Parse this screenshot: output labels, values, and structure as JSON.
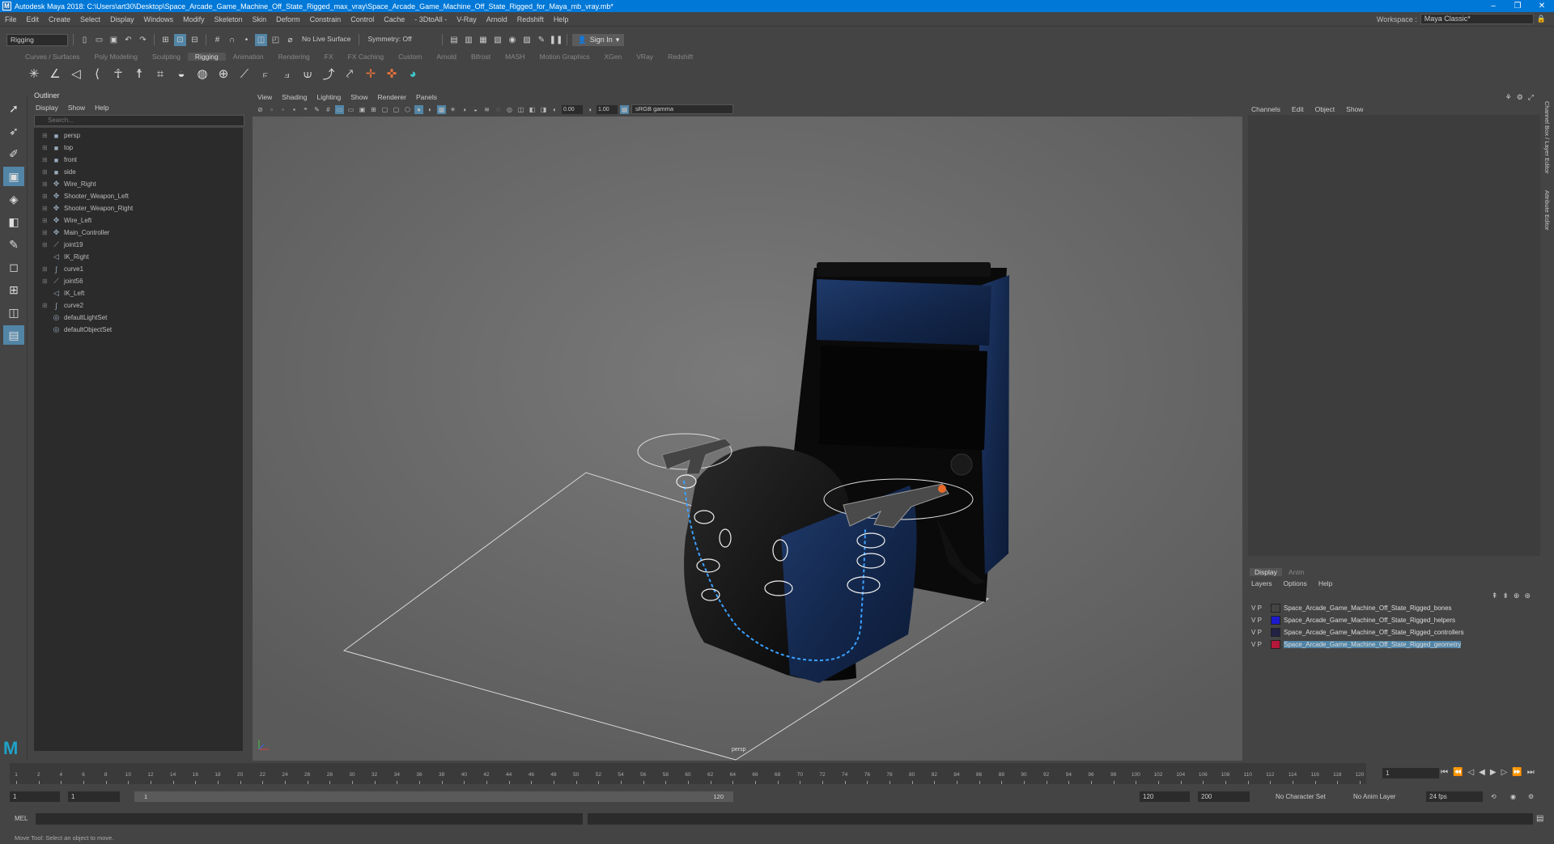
{
  "window": {
    "title": "Autodesk Maya 2018: C:\\Users\\art30\\Desktop\\Space_Arcade_Game_Machine_Off_State_Rigged_max_vray\\Space_Arcade_Game_Machine_Off_State_Rigged_for_Maya_mb_vray.mb*",
    "minimize": "–",
    "maximize": "❐",
    "close": "✕"
  },
  "menubar": {
    "items": [
      "File",
      "Edit",
      "Create",
      "Select",
      "Display",
      "Windows",
      "Modify",
      "Skeleton",
      "Skin",
      "Deform",
      "Constrain",
      "Control",
      "Cache",
      "- 3DtoAll -",
      "V-Ray",
      "Arnold",
      "Redshift",
      "Help"
    ],
    "workspace_label": "Workspace :",
    "workspace_value": "Maya Classic*"
  },
  "statusline": {
    "mode": "Rigging",
    "live_surface": "No Live Surface",
    "symmetry": "Symmetry: Off",
    "signin": "Sign In"
  },
  "shelf": {
    "tabs": [
      "Curves / Surfaces",
      "Poly Modeling",
      "Sculpting",
      "Rigging",
      "Animation",
      "Rendering",
      "FX",
      "FX Caching",
      "Custom",
      "Arnold",
      "Bifrost",
      "MASH",
      "Motion Graphics",
      "XGen",
      "VRay",
      "Redshift"
    ],
    "active_tab": "Rigging"
  },
  "outliner": {
    "header": "Outliner",
    "menu": [
      "Display",
      "Show",
      "Help"
    ],
    "search_placeholder": "Search...",
    "items": [
      {
        "label": "persp",
        "icon": "camera-icon"
      },
      {
        "label": "top",
        "icon": "camera-icon"
      },
      {
        "label": "front",
        "icon": "camera-icon"
      },
      {
        "label": "side",
        "icon": "camera-icon"
      },
      {
        "label": "Wire_Right",
        "icon": "transform-icon"
      },
      {
        "label": "Shooter_Weapon_Left",
        "icon": "transform-icon"
      },
      {
        "label": "Shooter_Weapon_Right",
        "icon": "transform-icon"
      },
      {
        "label": "Wire_Left",
        "icon": "transform-icon"
      },
      {
        "label": "Main_Controller",
        "icon": "transform-icon"
      },
      {
        "label": "joint19",
        "icon": "joint-icon"
      },
      {
        "label": "IK_Right",
        "icon": "ik-handle-icon"
      },
      {
        "label": "curve1",
        "icon": "curve-icon"
      },
      {
        "label": "joint56",
        "icon": "joint-icon"
      },
      {
        "label": "IK_Left",
        "icon": "ik-handle-icon"
      },
      {
        "label": "curve2",
        "icon": "curve-icon"
      },
      {
        "label": "defaultLightSet",
        "icon": "set-icon"
      },
      {
        "label": "defaultObjectSet",
        "icon": "set-icon"
      }
    ]
  },
  "viewport": {
    "menu": [
      "View",
      "Shading",
      "Lighting",
      "Show",
      "Renderer",
      "Panels"
    ],
    "exposure": "0.00",
    "gamma": "1.00",
    "color_space": "sRGB gamma",
    "camera_label": "persp"
  },
  "channel_box": {
    "menu": [
      "Channels",
      "Edit",
      "Object",
      "Show"
    ]
  },
  "layer_editor": {
    "tabs": [
      "Display",
      "Anim"
    ],
    "active_tab": "Display",
    "menu": [
      "Layers",
      "Options",
      "Help"
    ],
    "layers": [
      {
        "v": "V",
        "p": "P",
        "name": "Space_Arcade_Game_Machine_Off_State_Rigged_bones",
        "color": "#444444"
      },
      {
        "v": "V",
        "p": "P",
        "name": "Space_Arcade_Game_Machine_Off_State_Rigged_helpers",
        "color": "#1a1acc"
      },
      {
        "v": "V",
        "p": "P",
        "name": "Space_Arcade_Game_Machine_Off_State_Rigged_controllers",
        "color": "#222244"
      },
      {
        "v": "V",
        "p": "P",
        "name": "Space_Arcade_Game_Machine_Off_State_Rigged_geometry",
        "color": "#b3173a"
      }
    ]
  },
  "side_tabs": [
    "Channel Box / Layer Editor",
    "Attribute Editor"
  ],
  "timeslider": {
    "ticks": [
      "1",
      "2",
      "4",
      "6",
      "8",
      "10",
      "12",
      "14",
      "16",
      "18",
      "20",
      "22",
      "24",
      "26",
      "28",
      "30",
      "32",
      "34",
      "36",
      "38",
      "40",
      "42",
      "44",
      "46",
      "48",
      "50",
      "52",
      "54",
      "56",
      "58",
      "60",
      "62",
      "64",
      "66",
      "68",
      "70",
      "72",
      "74",
      "76",
      "78",
      "80",
      "82",
      "84",
      "86",
      "88",
      "90",
      "92",
      "94",
      "96",
      "98",
      "100",
      "102",
      "104",
      "106",
      "108",
      "110",
      "112",
      "114",
      "116",
      "118",
      "120"
    ],
    "current_frame": "1"
  },
  "rangebar": {
    "start": "1",
    "start2": "1",
    "slider_start": "1",
    "slider_end": "120",
    "end": "120",
    "end2": "200",
    "character_set": "No Character Set",
    "anim_layer": "No Anim Layer",
    "fps": "24 fps"
  },
  "commandline": {
    "label": "MEL"
  },
  "helpline": {
    "text": "Move Tool: Select an object to move."
  }
}
